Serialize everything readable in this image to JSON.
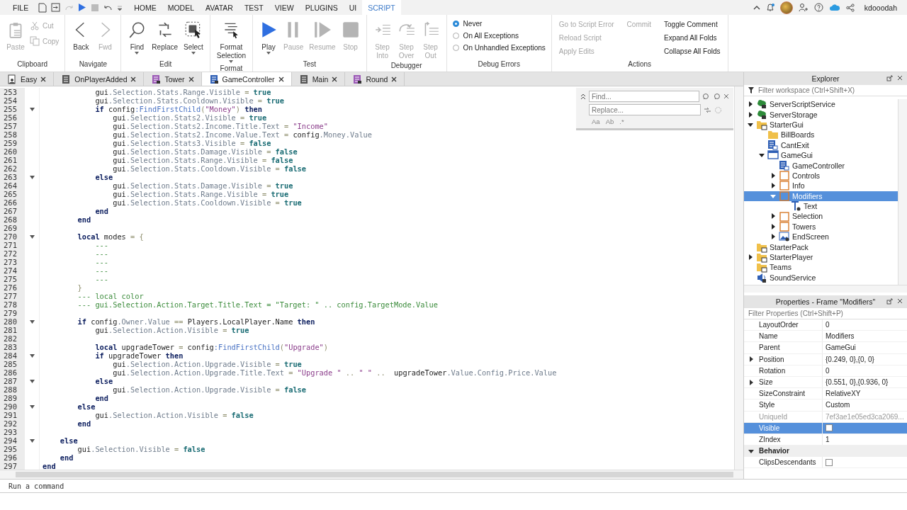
{
  "menu": {
    "file": "FILE",
    "tabs": [
      {
        "label": "HOME",
        "selected": false
      },
      {
        "label": "MODEL",
        "selected": false
      },
      {
        "label": "AVATAR",
        "selected": false
      },
      {
        "label": "TEST",
        "selected": false
      },
      {
        "label": "VIEW",
        "selected": false
      },
      {
        "label": "PLUGINS",
        "selected": false
      },
      {
        "label": "UI",
        "selected": false
      },
      {
        "label": "SCRIPT",
        "selected": true
      }
    ],
    "user": "kdooodah"
  },
  "ribbon": [
    {
      "title": "Clipboard",
      "items": [
        {
          "kind": "large",
          "label": "Paste",
          "disabled": true
        },
        {
          "kind": "stack",
          "items": [
            {
              "kind": "small",
              "label": "Cut",
              "disabled": true
            },
            {
              "kind": "small",
              "label": "Copy",
              "disabled": true
            }
          ]
        }
      ]
    },
    {
      "title": "Navigate",
      "items": [
        {
          "kind": "large",
          "label": "Back",
          "disabled": false
        },
        {
          "kind": "large",
          "label": "Fwd",
          "disabled": true
        }
      ]
    },
    {
      "title": "Edit",
      "items": [
        {
          "kind": "large",
          "label": "Find",
          "disabled": false,
          "dropdown": true
        },
        {
          "kind": "large",
          "label": "Replace",
          "disabled": false
        },
        {
          "kind": "large",
          "label": "Select",
          "disabled": false,
          "dropdown": true
        }
      ]
    },
    {
      "title": "Format",
      "items": [
        {
          "kind": "large",
          "label": "Format Selection",
          "disabled": false,
          "dropdown": true
        }
      ]
    },
    {
      "title": "Test",
      "items": [
        {
          "kind": "large",
          "label": "Play",
          "disabled": false,
          "dropdown": true
        },
        {
          "kind": "large",
          "label": "Pause",
          "disabled": true
        },
        {
          "kind": "large",
          "label": "Resume",
          "disabled": true
        },
        {
          "kind": "large",
          "label": "Stop",
          "disabled": true
        }
      ]
    },
    {
      "title": "Debugger",
      "items": [
        {
          "kind": "large",
          "label": "Step Into",
          "disabled": true
        },
        {
          "kind": "large",
          "label": "Step Over",
          "disabled": true
        },
        {
          "kind": "large",
          "label": "Step Out",
          "disabled": true
        }
      ]
    },
    {
      "title": "Debug Errors",
      "items": [
        {
          "kind": "stack",
          "items": [
            {
              "kind": "radio",
              "label": "Never",
              "selected": true
            },
            {
              "kind": "radio",
              "label": "On All Exceptions",
              "selected": false
            },
            {
              "kind": "radio",
              "label": "On Unhandled Exceptions",
              "selected": false
            }
          ]
        }
      ]
    },
    {
      "title": "Actions",
      "items": [
        {
          "kind": "stack",
          "items": [
            {
              "kind": "link",
              "label": "Go to Script Error",
              "disabled": true
            },
            {
              "kind": "link",
              "label": "Reload Script",
              "disabled": true
            },
            {
              "kind": "link",
              "label": "Apply Edits",
              "disabled": true
            }
          ]
        },
        {
          "kind": "stack",
          "items": [
            {
              "kind": "link",
              "label": "Commit",
              "disabled": true
            }
          ]
        },
        {
          "kind": "stack",
          "items": [
            {
              "kind": "link",
              "label": "Toggle Comment",
              "disabled": false
            },
            {
              "kind": "link",
              "label": "Expand All Folds",
              "disabled": false
            },
            {
              "kind": "link",
              "label": "Collapse All Folds",
              "disabled": false
            }
          ]
        }
      ]
    }
  ],
  "editor_tabs": [
    {
      "label": "Easy",
      "kind": "local",
      "selected": false
    },
    {
      "label": "OnPlayerAdded",
      "kind": "module",
      "selected": false
    },
    {
      "label": "Tower",
      "kind": "server",
      "selected": false
    },
    {
      "label": "GameController",
      "kind": "client",
      "selected": true
    },
    {
      "label": "Main",
      "kind": "module",
      "selected": false
    },
    {
      "label": "Round",
      "kind": "server",
      "selected": false
    }
  ],
  "find_panel": {
    "find_placeholder": "Find...",
    "replace_placeholder": "Replace...",
    "options": [
      "Aa",
      "Ab",
      ".*"
    ]
  },
  "code": [
    {
      "num": "253",
      "segs": [
        {
          "kind": "plain",
          "text": "            gui"
        },
        {
          "kind": "member",
          "text": ".Selection.Stats.Range.Visible"
        },
        {
          "kind": "op",
          "text": " = "
        },
        {
          "kind": "bool",
          "text": "true"
        }
      ]
    },
    {
      "num": "254",
      "segs": [
        {
          "kind": "plain",
          "text": "            gui"
        },
        {
          "kind": "member",
          "text": ".Selection.Stats.Cooldown.Visible"
        },
        {
          "kind": "op",
          "text": " = "
        },
        {
          "kind": "bool",
          "text": "true"
        }
      ]
    },
    {
      "num": "255",
      "fold": true,
      "segs": [
        {
          "kind": "keyword",
          "text": "            if"
        },
        {
          "kind": "plain",
          "text": " config"
        },
        {
          "kind": "func",
          "text": ":FindFirstChild"
        },
        {
          "kind": "op",
          "text": "("
        },
        {
          "kind": "string",
          "text": "\"Money\""
        },
        {
          "kind": "op",
          "text": ") "
        },
        {
          "kind": "keyword",
          "text": "then"
        }
      ]
    },
    {
      "num": "256",
      "segs": [
        {
          "kind": "plain",
          "text": "                gui"
        },
        {
          "kind": "member",
          "text": ".Selection.Stats2.Visible"
        },
        {
          "kind": "op",
          "text": " = "
        },
        {
          "kind": "bool",
          "text": "true"
        }
      ]
    },
    {
      "num": "257",
      "segs": [
        {
          "kind": "plain",
          "text": "                gui"
        },
        {
          "kind": "member",
          "text": ".Selection.Stats2.Income.Title.Text"
        },
        {
          "kind": "op",
          "text": " = "
        },
        {
          "kind": "string",
          "text": "\"Income\""
        }
      ]
    },
    {
      "num": "258",
      "segs": [
        {
          "kind": "plain",
          "text": "                gui"
        },
        {
          "kind": "member",
          "text": ".Selection.Stats2.Income.Value.Text"
        },
        {
          "kind": "op",
          "text": " = "
        },
        {
          "kind": "plain",
          "text": "config"
        },
        {
          "kind": "member",
          "text": ".Money.Value"
        }
      ]
    },
    {
      "num": "259",
      "segs": [
        {
          "kind": "plain",
          "text": "                gui"
        },
        {
          "kind": "member",
          "text": ".Selection.Stats3.Visible"
        },
        {
          "kind": "op",
          "text": " = "
        },
        {
          "kind": "bool",
          "text": "false"
        }
      ]
    },
    {
      "num": "260",
      "segs": [
        {
          "kind": "plain",
          "text": "                gui"
        },
        {
          "kind": "member",
          "text": ".Selection.Stats.Damage.Visible"
        },
        {
          "kind": "op",
          "text": " = "
        },
        {
          "kind": "bool",
          "text": "false"
        }
      ]
    },
    {
      "num": "261",
      "segs": [
        {
          "kind": "plain",
          "text": "                gui"
        },
        {
          "kind": "member",
          "text": ".Selection.Stats.Range.Visible"
        },
        {
          "kind": "op",
          "text": " = "
        },
        {
          "kind": "bool",
          "text": "false"
        }
      ]
    },
    {
      "num": "262",
      "segs": [
        {
          "kind": "plain",
          "text": "                gui"
        },
        {
          "kind": "member",
          "text": ".Selection.Stats.Cooldown.Visible"
        },
        {
          "kind": "op",
          "text": " = "
        },
        {
          "kind": "bool",
          "text": "false"
        }
      ]
    },
    {
      "num": "263",
      "fold": true,
      "segs": [
        {
          "kind": "keyword",
          "text": "            else"
        }
      ]
    },
    {
      "num": "264",
      "segs": [
        {
          "kind": "plain",
          "text": "                gui"
        },
        {
          "kind": "member",
          "text": ".Selection.Stats.Damage.Visible"
        },
        {
          "kind": "op",
          "text": " = "
        },
        {
          "kind": "bool",
          "text": "true"
        }
      ]
    },
    {
      "num": "265",
      "segs": [
        {
          "kind": "plain",
          "text": "                gui"
        },
        {
          "kind": "member",
          "text": ".Selection.Stats.Range.Visible"
        },
        {
          "kind": "op",
          "text": " = "
        },
        {
          "kind": "bool",
          "text": "true"
        }
      ]
    },
    {
      "num": "266",
      "segs": [
        {
          "kind": "plain",
          "text": "                gui"
        },
        {
          "kind": "member",
          "text": ".Selection.Stats.Cooldown.Visible"
        },
        {
          "kind": "op",
          "text": " = "
        },
        {
          "kind": "bool",
          "text": "true"
        }
      ]
    },
    {
      "num": "267",
      "segs": [
        {
          "kind": "keyword",
          "text": "            end"
        }
      ]
    },
    {
      "num": "268",
      "segs": [
        {
          "kind": "keyword",
          "text": "        end"
        }
      ]
    },
    {
      "num": "269"
    },
    {
      "num": "270",
      "fold": true,
      "segs": [
        {
          "kind": "keyword",
          "text": "        local"
        },
        {
          "kind": "plain",
          "text": " modes"
        },
        {
          "kind": "op",
          "text": " = {"
        }
      ]
    },
    {
      "num": "271",
      "segs": [
        {
          "kind": "comment",
          "text": "            ---"
        }
      ]
    },
    {
      "num": "272",
      "segs": [
        {
          "kind": "comment",
          "text": "            ---"
        }
      ]
    },
    {
      "num": "273",
      "segs": [
        {
          "kind": "comment",
          "text": "            ---"
        }
      ]
    },
    {
      "num": "274",
      "segs": [
        {
          "kind": "comment",
          "text": "            ---"
        }
      ]
    },
    {
      "num": "275",
      "segs": [
        {
          "kind": "comment",
          "text": "            ---"
        }
      ]
    },
    {
      "num": "276",
      "segs": [
        {
          "kind": "op",
          "text": "        }"
        }
      ]
    },
    {
      "num": "277",
      "segs": [
        {
          "kind": "comment",
          "text": "        --- local color"
        }
      ]
    },
    {
      "num": "278",
      "segs": [
        {
          "kind": "comment",
          "text": "        --- gui.Selection.Action.Target.Title.Text = \"Target: \" .. config.TargetMode.Value"
        }
      ]
    },
    {
      "num": "279"
    },
    {
      "num": "280",
      "fold": true,
      "segs": [
        {
          "kind": "keyword",
          "text": "        if"
        },
        {
          "kind": "plain",
          "text": " config"
        },
        {
          "kind": "member",
          "text": ".Owner.Value"
        },
        {
          "kind": "op",
          "text": " == "
        },
        {
          "kind": "plain",
          "text": "Players.LocalPlayer.Name"
        },
        {
          "kind": "keyword",
          "text": " then"
        }
      ]
    },
    {
      "num": "281",
      "segs": [
        {
          "kind": "plain",
          "text": "            gui"
        },
        {
          "kind": "member",
          "text": ".Selection.Action.Visible"
        },
        {
          "kind": "op",
          "text": " = "
        },
        {
          "kind": "bool",
          "text": "true"
        }
      ]
    },
    {
      "num": "282"
    },
    {
      "num": "283",
      "segs": [
        {
          "kind": "keyword",
          "text": "            local"
        },
        {
          "kind": "plain",
          "text": " upgradeTower"
        },
        {
          "kind": "op",
          "text": " = "
        },
        {
          "kind": "plain",
          "text": "config"
        },
        {
          "kind": "func",
          "text": ":FindFirstChild"
        },
        {
          "kind": "op",
          "text": "("
        },
        {
          "kind": "string",
          "text": "\"Upgrade\""
        },
        {
          "kind": "op",
          "text": ")"
        }
      ]
    },
    {
      "num": "284",
      "fold": true,
      "segs": [
        {
          "kind": "keyword",
          "text": "            if"
        },
        {
          "kind": "plain",
          "text": " upgradeTower "
        },
        {
          "kind": "keyword",
          "text": "then"
        }
      ]
    },
    {
      "num": "285",
      "segs": [
        {
          "kind": "plain",
          "text": "                gui"
        },
        {
          "kind": "member",
          "text": ".Selection.Action.Upgrade.Visible"
        },
        {
          "kind": "op",
          "text": " = "
        },
        {
          "kind": "bool",
          "text": "true"
        }
      ]
    },
    {
      "num": "286",
      "segs": [
        {
          "kind": "plain",
          "text": "                gui"
        },
        {
          "kind": "member",
          "text": ".Selection.Action.Upgrade.Title.Text"
        },
        {
          "kind": "op",
          "text": " = "
        },
        {
          "kind": "string",
          "text": "\"Upgrade \""
        },
        {
          "kind": "op",
          "text": " .. "
        },
        {
          "kind": "string",
          "text": "\" \""
        },
        {
          "kind": "op",
          "text": " ..  "
        },
        {
          "kind": "plain",
          "text": "upgradeTower"
        },
        {
          "kind": "member",
          "text": ".Value.Config.Price.Value"
        }
      ]
    },
    {
      "num": "287",
      "fold": true,
      "segs": [
        {
          "kind": "keyword",
          "text": "            else"
        }
      ]
    },
    {
      "num": "288",
      "segs": [
        {
          "kind": "plain",
          "text": "                gui"
        },
        {
          "kind": "member",
          "text": ".Selection.Action.Upgrade.Visible"
        },
        {
          "kind": "op",
          "text": " = "
        },
        {
          "kind": "bool",
          "text": "false"
        }
      ]
    },
    {
      "num": "289",
      "segs": [
        {
          "kind": "keyword",
          "text": "            end"
        }
      ]
    },
    {
      "num": "290",
      "fold": true,
      "segs": [
        {
          "kind": "keyword",
          "text": "        else"
        }
      ]
    },
    {
      "num": "291",
      "segs": [
        {
          "kind": "plain",
          "text": "            gui"
        },
        {
          "kind": "member",
          "text": ".Selection.Action.Visible"
        },
        {
          "kind": "op",
          "text": " = "
        },
        {
          "kind": "bool",
          "text": "false"
        }
      ]
    },
    {
      "num": "292",
      "segs": [
        {
          "kind": "keyword",
          "text": "        end"
        }
      ]
    },
    {
      "num": "293"
    },
    {
      "num": "294",
      "fold": true,
      "segs": [
        {
          "kind": "keyword",
          "text": "    else"
        }
      ]
    },
    {
      "num": "295",
      "segs": [
        {
          "kind": "plain",
          "text": "        gui"
        },
        {
          "kind": "member",
          "text": ".Selection.Visible"
        },
        {
          "kind": "op",
          "text": " = "
        },
        {
          "kind": "bool",
          "text": "false"
        }
      ]
    },
    {
      "num": "296",
      "segs": [
        {
          "kind": "keyword",
          "text": "    end"
        }
      ]
    },
    {
      "num": "297",
      "segs": [
        {
          "kind": "keyword",
          "text": "end"
        }
      ]
    }
  ],
  "explorer": {
    "title": "Explorer",
    "filter_placeholder": "Filter workspace (Ctrl+Shift+X)",
    "tree": [
      {
        "name": "ServerScriptService",
        "kind": "service",
        "expanded": false,
        "selected": false
      },
      {
        "name": "ServerStorage",
        "kind": "service",
        "expanded": false,
        "selected": false
      },
      {
        "name": "StarterGui",
        "kind": "container",
        "expanded": true,
        "selected": false,
        "children": [
          {
            "name": "BillBoards",
            "kind": "folder",
            "selected": false
          },
          {
            "name": "CantExit",
            "kind": "script",
            "selected": false
          },
          {
            "name": "GameGui",
            "kind": "gui",
            "expanded": true,
            "selected": false,
            "children": [
              {
                "name": "GameController",
                "kind": "script",
                "selected": false
              },
              {
                "name": "Controls",
                "kind": "frame",
                "expanded": false,
                "selected": false
              },
              {
                "name": "Info",
                "kind": "frame",
                "expanded": false,
                "selected": false
              },
              {
                "name": "Modifiers",
                "kind": "frame",
                "expanded": true,
                "selected": true,
                "children": [
                  {
                    "name": "Text",
                    "kind": "label",
                    "selected": false
                  }
                ]
              },
              {
                "name": "Selection",
                "kind": "frame",
                "expanded": false,
                "selected": false
              },
              {
                "name": "Towers",
                "kind": "frame",
                "expanded": false,
                "selected": false
              },
              {
                "name": "EndScreen",
                "kind": "image",
                "expanded": false,
                "selected": false
              }
            ]
          }
        ]
      },
      {
        "name": "StarterPack",
        "kind": "container",
        "selected": false
      },
      {
        "name": "StarterPlayer",
        "kind": "container",
        "expanded": false,
        "selected": false
      },
      {
        "name": "Teams",
        "kind": "container",
        "selected": false
      },
      {
        "name": "SoundService",
        "kind": "sound",
        "selected": false
      }
    ]
  },
  "properties": {
    "title": "Properties - Frame \"Modifiers\"",
    "filter_placeholder": "Filter Properties (Ctrl+Shift+P)",
    "rows": [
      {
        "kind": "text",
        "name": "LayoutOrder",
        "value": "0",
        "selected": false
      },
      {
        "kind": "text",
        "name": "Name",
        "value": "Modifiers",
        "selected": false
      },
      {
        "kind": "text",
        "name": "Parent",
        "value": "GameGui",
        "selected": false
      },
      {
        "kind": "text",
        "name": "Position",
        "value": "{0.249, 0},{0, 0}",
        "expanded": false,
        "selected": false
      },
      {
        "kind": "text",
        "name": "Rotation",
        "value": "0",
        "selected": false
      },
      {
        "kind": "text",
        "name": "Size",
        "value": "{0.551, 0},{0.936, 0}",
        "expanded": false,
        "selected": false
      },
      {
        "kind": "text",
        "name": "SizeConstraint",
        "value": "RelativeXY",
        "selected": false
      },
      {
        "kind": "text",
        "name": "Style",
        "value": "Custom",
        "selected": false
      },
      {
        "kind": "text",
        "name": "UniqueId",
        "value": "7ef3ae1e05ed3ca2069...",
        "disabled": true,
        "selected": false
      },
      {
        "kind": "checkbox",
        "name": "Visible",
        "checked": false,
        "selected": true
      },
      {
        "kind": "text",
        "name": "ZIndex",
        "value": "1",
        "selected": false
      },
      {
        "kind": "section",
        "name": "Behavior",
        "expanded": true
      },
      {
        "kind": "checkbox",
        "name": "ClipsDescendants",
        "checked": false,
        "selected": false
      }
    ]
  },
  "command_bar": {
    "placeholder": "Run a command"
  }
}
